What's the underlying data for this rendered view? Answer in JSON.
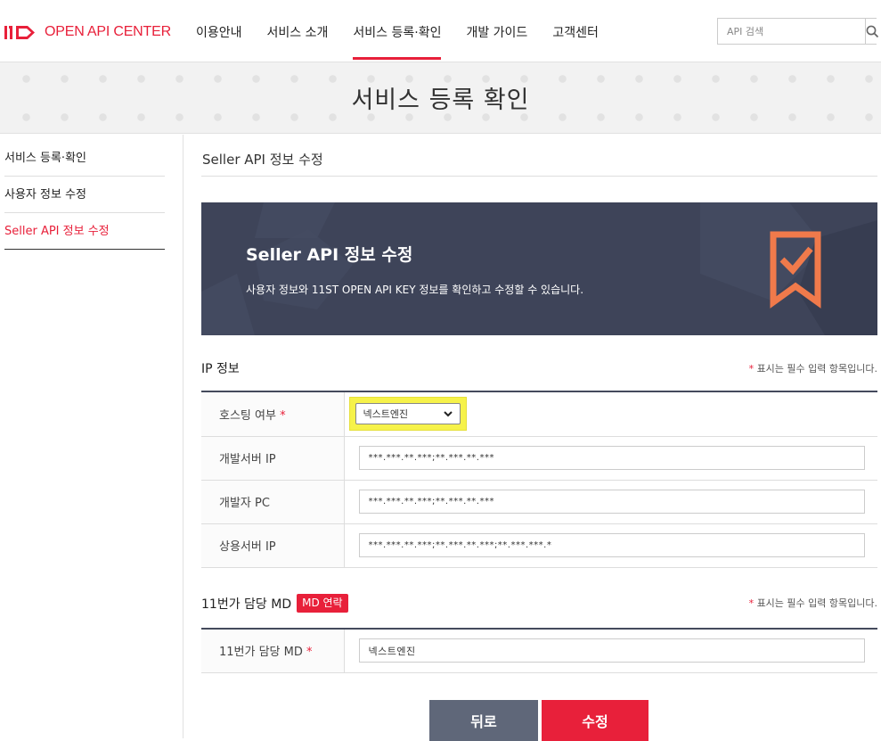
{
  "header": {
    "logo_text": "OPEN API CENTER",
    "nav": [
      "이용안내",
      "서비스 소개",
      "서비스 등록·확인",
      "개발 가이드",
      "고객센터"
    ],
    "active_nav": 2,
    "search_placeholder": "API 검색"
  },
  "banner": {
    "title": "서비스 등록 확인"
  },
  "sidebar": {
    "items": [
      {
        "label": "서비스 등록·확인"
      },
      {
        "label": "사용자 정보 수정"
      },
      {
        "label": "Seller API 정보 수정"
      }
    ],
    "active": 2
  },
  "main": {
    "heading": "Seller API 정보 수정",
    "hero": {
      "title": "Seller API 정보 수정",
      "description": "사용자 정보와 11ST OPEN API KEY 정보를 확인하고 수정할 수 있습니다."
    },
    "ip_section": {
      "title": "IP 정보",
      "required_note": "표시는 필수 입력 항목입니다.",
      "required_mark": "*",
      "rows": {
        "hosting": {
          "label": "호스팅 여부",
          "value": "넥스트엔진"
        },
        "dev_server": {
          "label": "개발서버 IP",
          "value": "***.***.**.***;**.***.**.***"
        },
        "dev_pc": {
          "label": "개발자 PC",
          "value": "***.***.**.***;**.***.**.***"
        },
        "prod_server": {
          "label": "상용서버 IP",
          "value": "***.***.**.***;**.***.**.***;**.***.***.*"
        }
      }
    },
    "md_section": {
      "title": "11번가 담당 MD",
      "badge": "MD 연락",
      "required_note": "표시는 필수 입력 항목입니다.",
      "row": {
        "label": "11번가 담당 MD",
        "value": "넥스트엔진"
      }
    },
    "buttons": {
      "back": "뒤로",
      "submit": "수정"
    }
  },
  "colors": {
    "accent": "#e8203a",
    "hero_bg": "#3e4459",
    "hero_icon": "#f07a4b",
    "highlight": "#f6f24a"
  }
}
